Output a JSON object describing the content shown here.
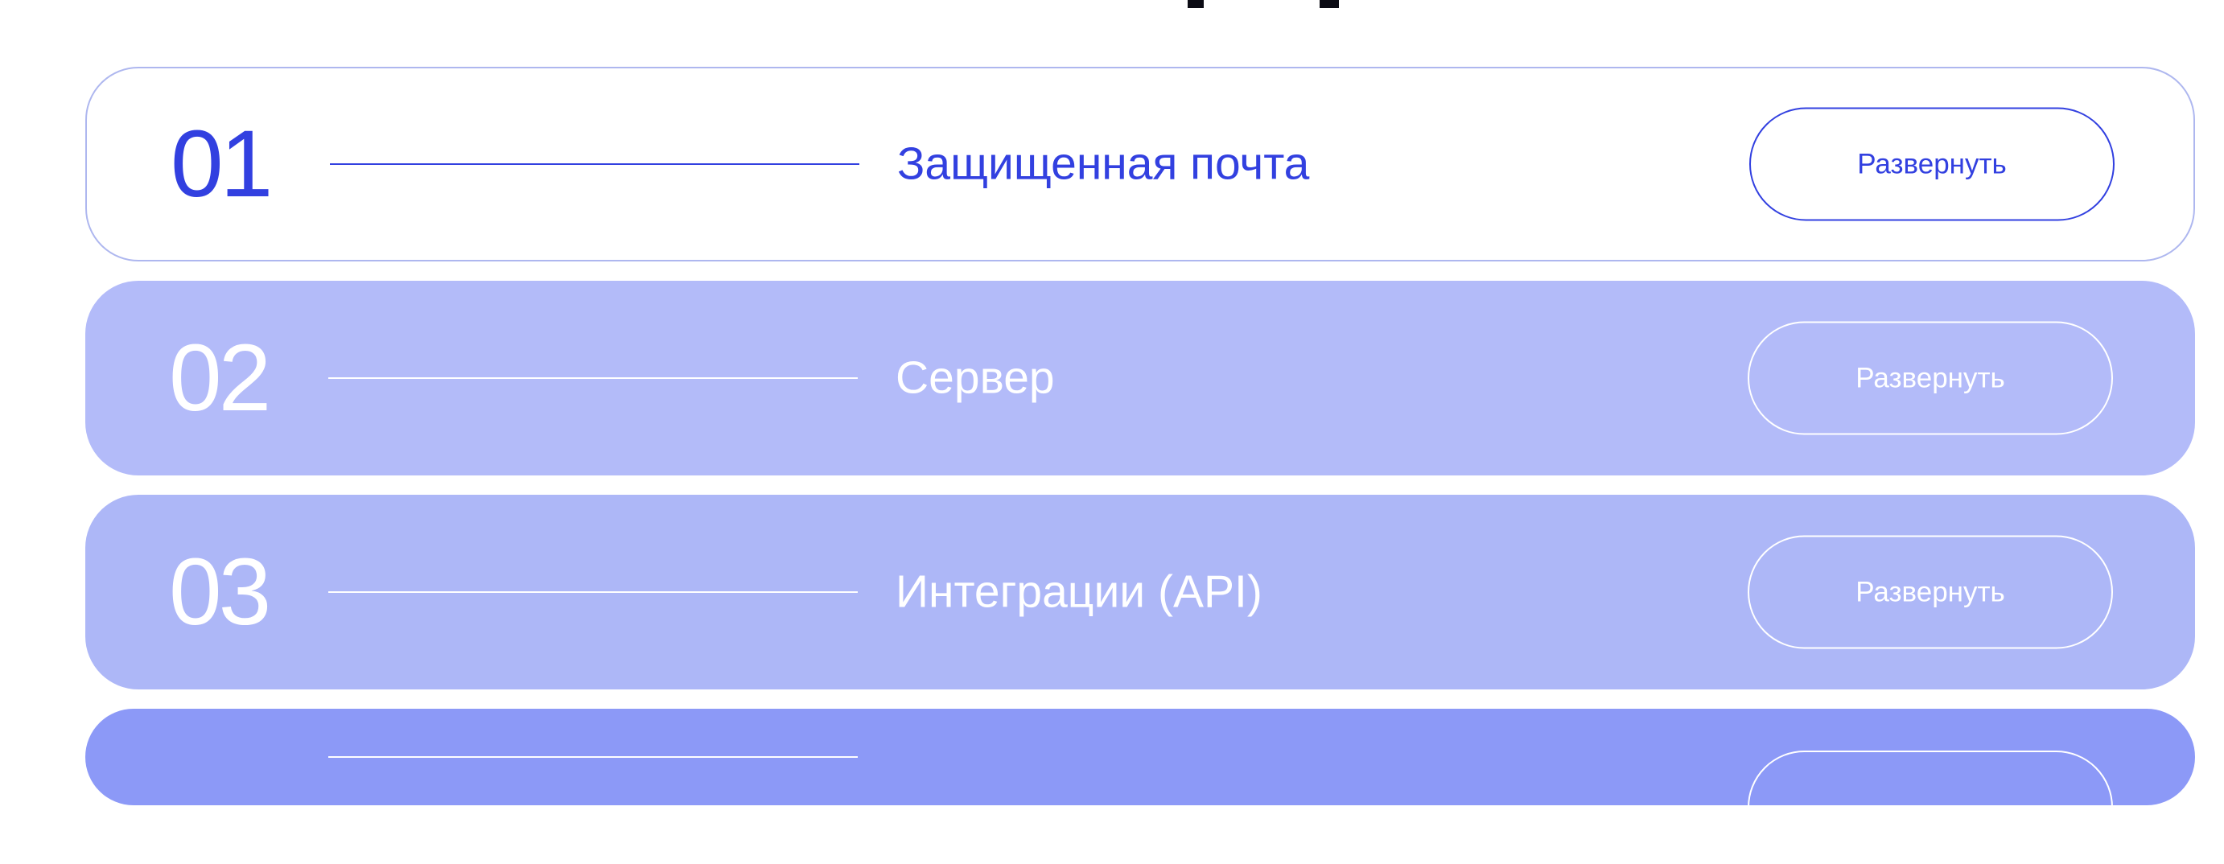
{
  "page": {
    "heading_partial": ""
  },
  "accordion": {
    "items": [
      {
        "number": "01",
        "title": "Защищенная почта",
        "toggle_label": "Развернуть",
        "state": "active",
        "number_color": "#3240E0",
        "background": "#FFFFFF"
      },
      {
        "number": "02",
        "title": "Сервер",
        "toggle_label": "Развернуть",
        "state": "collapsed",
        "number_color": "#FFFFFF",
        "background": "#B3BBF9"
      },
      {
        "number": "03",
        "title": "Интеграции (API)",
        "toggle_label": "Развернуть",
        "state": "collapsed",
        "number_color": "#FFFFFF",
        "background": "#ADB7F7"
      },
      {
        "number": "",
        "title": "",
        "toggle_label": "",
        "state": "collapsed",
        "number_color": "#FFFFFF",
        "background": "#8C99F7"
      }
    ]
  },
  "colors": {
    "accent": "#3240E0",
    "panel_border": "#AEB7EF",
    "page_background": "#FFFFFF"
  }
}
